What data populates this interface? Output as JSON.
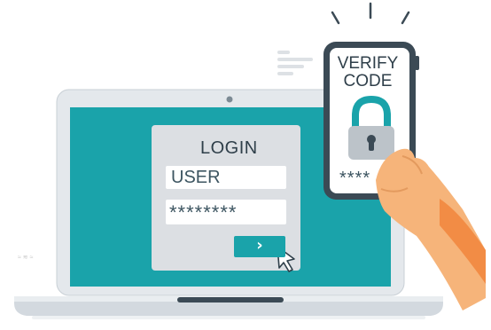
{
  "login": {
    "title": "LOGIN",
    "username_value": "USER",
    "password_value": "********",
    "submit_glyph": "›"
  },
  "phone": {
    "heading": "VERIFY\nCODE",
    "code_mask": "****",
    "icon": "padlock-icon"
  },
  "watermark": "≈ ≋ ≈",
  "colors": {
    "teal": "#1aa3aa",
    "panel": "#dcdfe3",
    "laptop_frame": "#e4e8ec",
    "skin": "#f6b47a",
    "sleeve": "#f28c45"
  }
}
